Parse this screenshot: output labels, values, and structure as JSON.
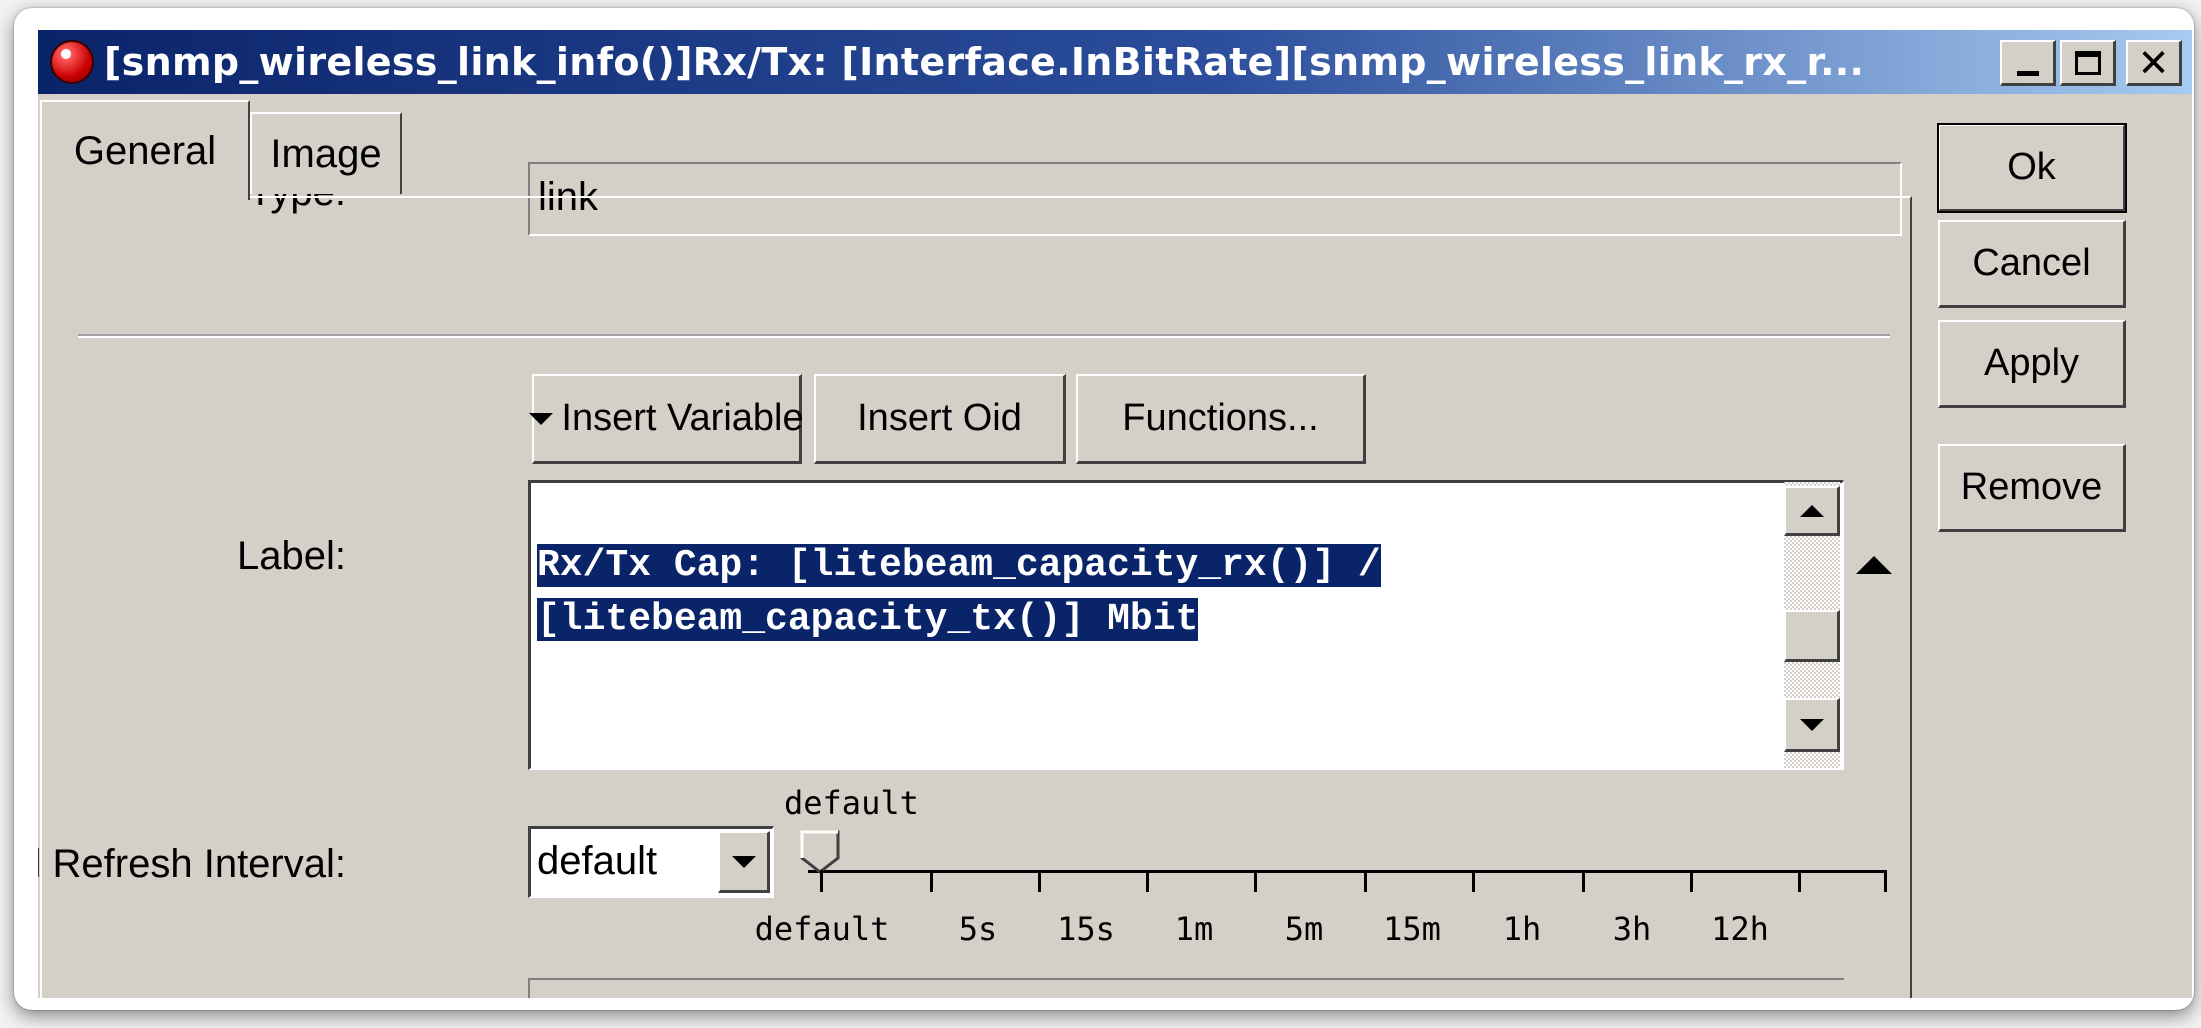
{
  "window": {
    "title": "[snmp_wireless_link_info()]Rx/Tx: [Interface.InBitRate][snmp_wireless_link_rx_r..."
  },
  "tabs": [
    {
      "label": "General",
      "active": true
    },
    {
      "label": "Image",
      "active": false
    }
  ],
  "form": {
    "type_label": "Type:",
    "type_value": "link",
    "label_label": "Label:",
    "insert_variable": "Insert Variable",
    "insert_oid": "Insert Oid",
    "functions": "Functions...",
    "label_lines": [
      "Rx/Tx Cap: [litebeam_capacity_rx()] /",
      "[litebeam_capacity_tx()] Mbit"
    ],
    "refresh_label": "Label Refresh Interval:",
    "refresh_value": "default",
    "slider": {
      "current": "default",
      "ticks": [
        "default",
        "5s",
        "15s",
        "1m",
        "5m",
        "15m",
        "1h",
        "3h",
        "12h"
      ]
    }
  },
  "actions": {
    "ok": "Ok",
    "cancel": "Cancel",
    "apply": "Apply",
    "remove": "Remove"
  },
  "icons": {
    "app": "app-icon",
    "minimize": "minimize-icon",
    "maximize": "maximize-icon",
    "close": "close-icon"
  },
  "colors": {
    "titlebar_start": "#0a246a",
    "titlebar_end": "#a6caf0",
    "face": "#d4d0c8",
    "selection": "#0a246a"
  }
}
